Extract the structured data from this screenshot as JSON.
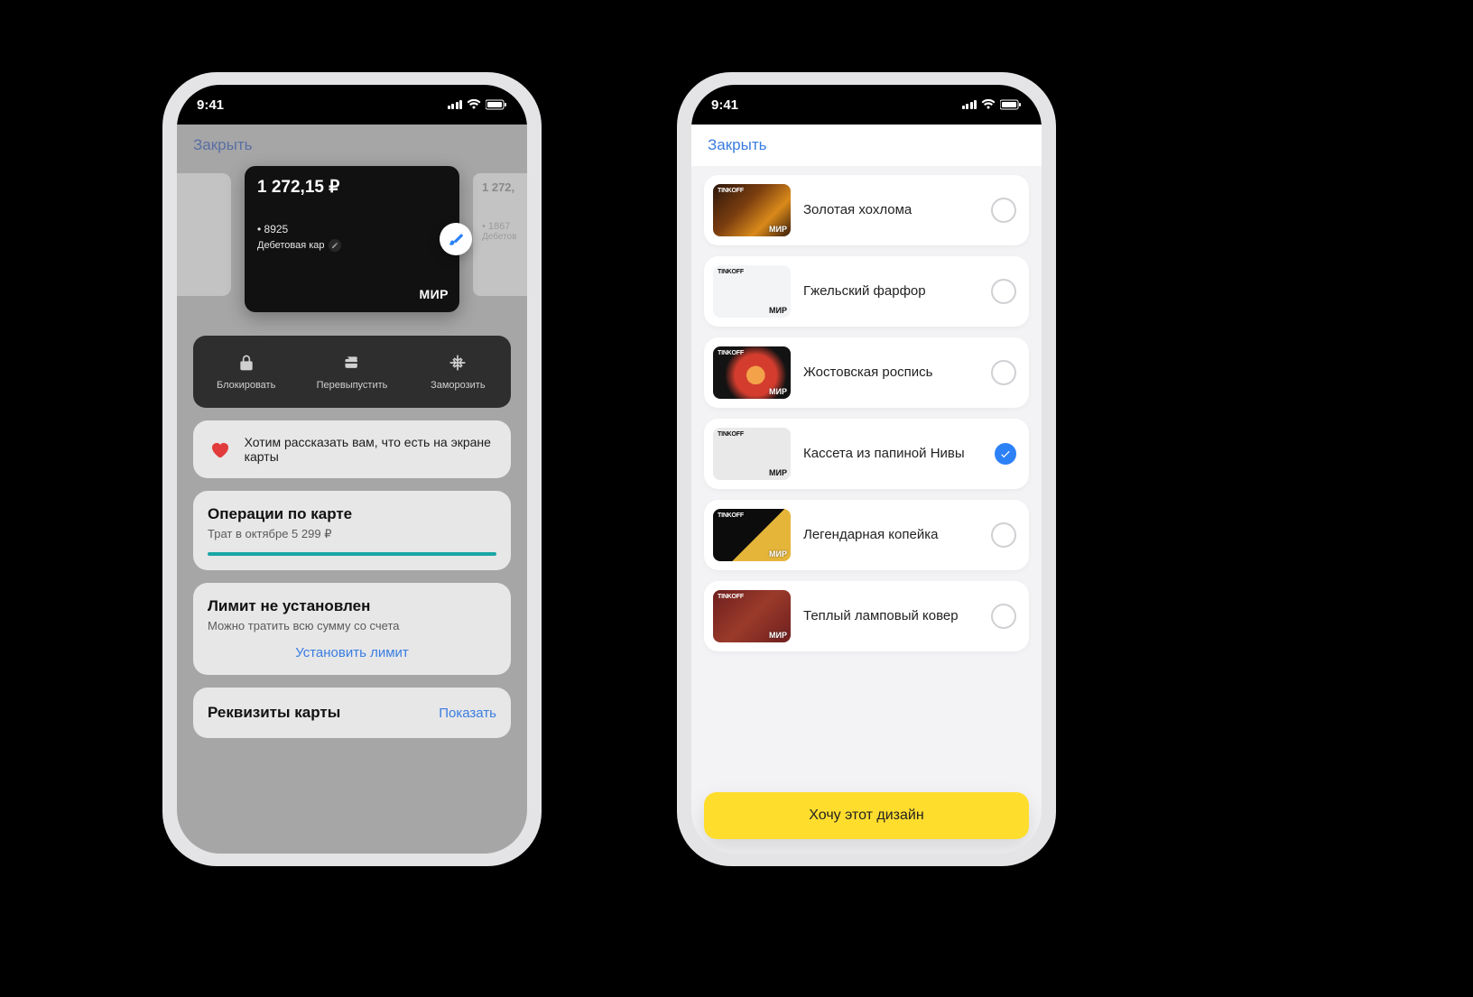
{
  "statusbar": {
    "time": "9:41"
  },
  "left": {
    "close": "Закрыть",
    "side_left_balance": "",
    "side_right_balance": "1 272,",
    "side_right_num": "• 1867",
    "side_right_type": "Дебетов",
    "card": {
      "balance": "1 272,15 ₽",
      "last4": "• 8925",
      "type_label": "Дебетовая кар",
      "scheme": "МИР"
    },
    "actions": [
      {
        "key": "lock",
        "label": "Блокировать"
      },
      {
        "key": "reissue",
        "label": "Перевыпустить"
      },
      {
        "key": "freeze",
        "label": "Заморозить"
      }
    ],
    "info_text": "Хотим рассказать вам, что есть на экране карты",
    "ops": {
      "title": "Операции по карте",
      "sub": "Трат в октябре 5 299 ₽"
    },
    "limit": {
      "title": "Лимит не установлен",
      "sub": "Можно тратить всю сумму со счета",
      "link": "Установить лимит"
    },
    "requisites": {
      "title": "Реквизиты карты",
      "action": "Показать"
    }
  },
  "right": {
    "close": "Закрыть",
    "designs": [
      {
        "name": "Золотая хохлома",
        "bg": "linear-gradient(135deg,#2c170b,#7a3d10 40%,#d98a1a 70%,#3a1c0a)",
        "selected": false
      },
      {
        "name": "Гжельский фарфор",
        "bg": "#f3f4f6",
        "white": true,
        "selected": false
      },
      {
        "name": "Жостовская роспись",
        "bg": "radial-gradient(circle at 55% 55%,#f4a24a 0 18%,#d43d2e 18% 40%,#131313 60%)",
        "selected": false
      },
      {
        "name": "Кассета из папиной Нивы",
        "bg": "#e9e9ea",
        "white": true,
        "selected": true
      },
      {
        "name": "Легендарная копейка",
        "bg": "linear-gradient(135deg,#0c0c0c 55%,#e5b53a 55%)",
        "selected": false
      },
      {
        "name": "Теплый ламповый ковер",
        "bg": "linear-gradient(135deg,#6e1f1f,#9a3a2a 50%,#6e1f1f)",
        "selected": false
      }
    ],
    "cta": "Хочу этот дизайн",
    "thumb_brand": "TINKOFF",
    "thumb_scheme": "МИР"
  }
}
